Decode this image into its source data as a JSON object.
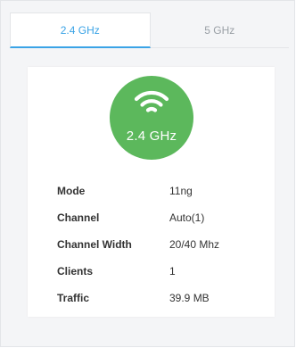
{
  "tabs": [
    {
      "label": "2.4 GHz",
      "active": true
    },
    {
      "label": "5 GHz",
      "active": false
    }
  ],
  "badge": {
    "icon": "wifi-icon",
    "label": "2.4 GHz",
    "color": "#5cb85c"
  },
  "details": [
    {
      "key": "Mode",
      "value": "11ng"
    },
    {
      "key": "Channel",
      "value": "Auto(1)"
    },
    {
      "key": "Channel Width",
      "value": "20/40 Mhz"
    },
    {
      "key": "Clients",
      "value": "1"
    },
    {
      "key": "Traffic",
      "value": "39.9 MB"
    }
  ],
  "colors": {
    "accent": "#3aa3e6",
    "inactive_tab_text": "#9aa0a6",
    "panel_bg": "#f4f5f7"
  }
}
